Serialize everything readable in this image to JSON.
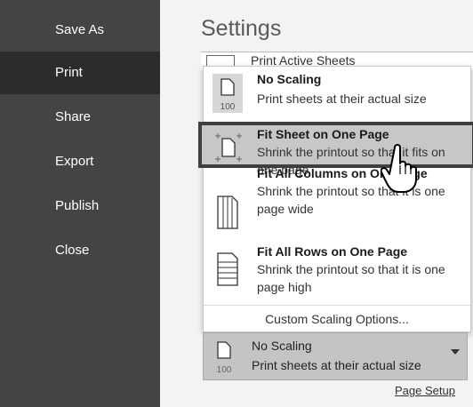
{
  "sidebar": {
    "items": [
      {
        "label": "Save As"
      },
      {
        "label": "Print"
      },
      {
        "label": "Share"
      },
      {
        "label": "Export"
      },
      {
        "label": "Publish"
      },
      {
        "label": "Close"
      }
    ],
    "active": "Print"
  },
  "settings": {
    "title": "Settings",
    "behind_label": "Print Active Sheets"
  },
  "scaling_menu": {
    "options": [
      {
        "title": "No Scaling",
        "desc": "Print sheets at their actual size",
        "icon": "no-scaling-icon",
        "icon_text": "100"
      },
      {
        "title": "Fit Sheet on One Page",
        "desc": "Shrink the printout so that it fits on one page",
        "icon": "fit-sheet-icon"
      },
      {
        "title": "Fit All Columns on One Page",
        "desc": "Shrink the printout so that it is one page wide",
        "icon": "fit-columns-icon"
      },
      {
        "title": "Fit All Rows on One Page",
        "desc": "Shrink the printout so that it is one page high",
        "icon": "fit-rows-icon"
      }
    ],
    "highlighted": "Fit Sheet on One Page",
    "custom_label": "Custom Scaling Options..."
  },
  "current_selection": {
    "title": "No Scaling",
    "desc": "Print sheets at their actual size",
    "icon_text": "100"
  },
  "footer": {
    "page_setup": "Page Setup"
  },
  "colors": {
    "sidebar_bg": "#444444",
    "sidebar_active": "#2c2c2c",
    "highlight_bg": "#c7c7c7",
    "highlight_border": "#3f3f3f"
  }
}
